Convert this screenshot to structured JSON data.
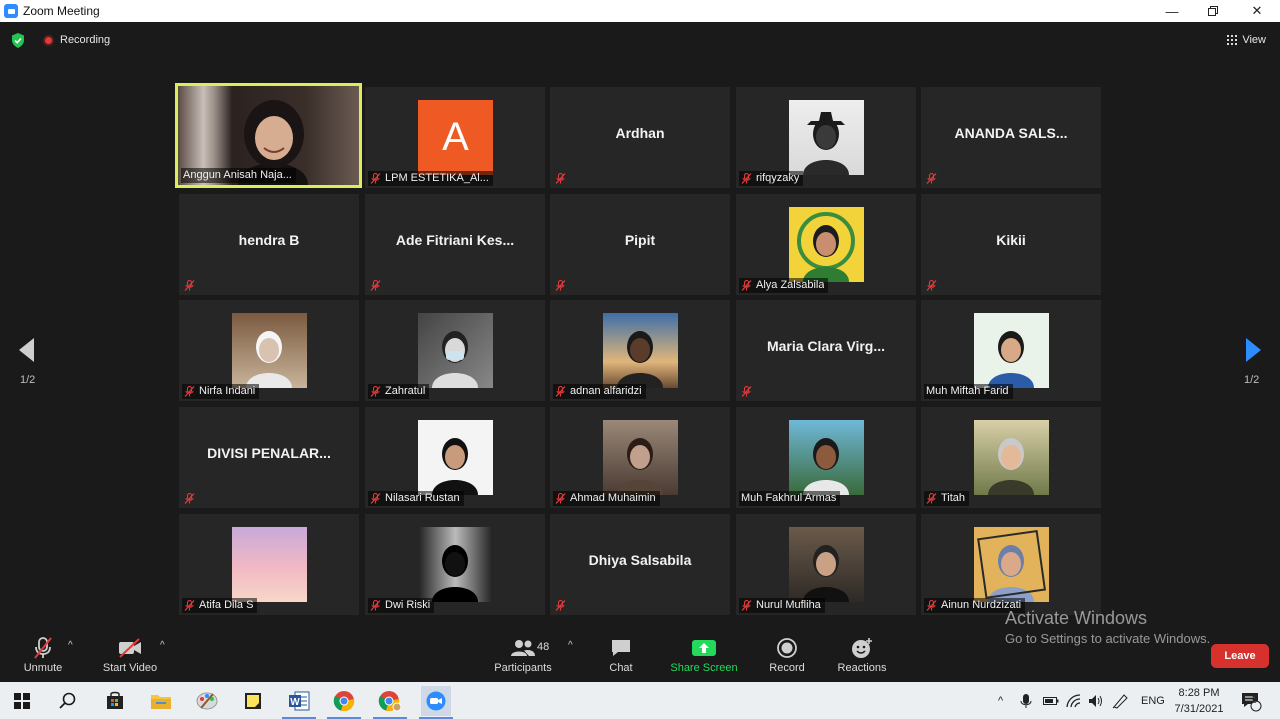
{
  "window": {
    "title": "Zoom Meeting",
    "controls": [
      "minimize",
      "restore",
      "close"
    ]
  },
  "meeting_top": {
    "recording_label": "Recording",
    "view_label": "View"
  },
  "nav": {
    "left_page": "1/2",
    "right_page": "1/2"
  },
  "participants_grid": [
    {
      "name": "Anggun Anisah Naja...",
      "muted": false,
      "display": "video",
      "active": true,
      "big_name": ""
    },
    {
      "name": "LPM ESTETIKA_Al...",
      "muted": true,
      "display": "avatar",
      "avatar_letter": "A",
      "avatar_color": "#ef5a24",
      "big_name": ""
    },
    {
      "name": "",
      "muted": true,
      "display": "name",
      "big_name": "Ardhan"
    },
    {
      "name": "rifqyzaky",
      "muted": true,
      "display": "photo",
      "big_name": ""
    },
    {
      "name": "",
      "muted": true,
      "display": "name",
      "big_name": "ANANDA SALS..."
    },
    {
      "name": "",
      "muted": true,
      "display": "name",
      "big_name": "hendra B"
    },
    {
      "name": "",
      "muted": true,
      "display": "name",
      "big_name": "Ade Fitriani Kes..."
    },
    {
      "name": "",
      "muted": true,
      "display": "name",
      "big_name": "Pipit"
    },
    {
      "name": "Alya Zalsabila",
      "muted": true,
      "display": "photo",
      "big_name": ""
    },
    {
      "name": "",
      "muted": true,
      "display": "name",
      "big_name": "Kikii"
    },
    {
      "name": "Nirfa Indani",
      "muted": true,
      "display": "photo",
      "big_name": ""
    },
    {
      "name": "Zahratul",
      "muted": true,
      "display": "photo",
      "big_name": ""
    },
    {
      "name": "adnan alfaridzi",
      "muted": true,
      "display": "photo",
      "big_name": ""
    },
    {
      "name": "",
      "muted": true,
      "display": "name",
      "big_name": "Maria Clara Virg..."
    },
    {
      "name": "Muh Miftah Farid",
      "muted": false,
      "display": "photo",
      "big_name": ""
    },
    {
      "name": "",
      "muted": true,
      "display": "name",
      "big_name": "DIVISI PENALAR..."
    },
    {
      "name": "Nilasari Rustan",
      "muted": true,
      "display": "photo",
      "big_name": ""
    },
    {
      "name": "Ahmad Muhaimin",
      "muted": true,
      "display": "photo",
      "big_name": ""
    },
    {
      "name": "Muh Fakhrul Armas",
      "muted": false,
      "display": "photo",
      "big_name": ""
    },
    {
      "name": "Titah",
      "muted": true,
      "display": "photo",
      "big_name": ""
    },
    {
      "name": "Atifa Dila S",
      "muted": true,
      "display": "photo",
      "big_name": ""
    },
    {
      "name": "Dwi Riski",
      "muted": true,
      "display": "photo",
      "big_name": ""
    },
    {
      "name": "",
      "muted": true,
      "display": "name",
      "big_name": "Dhiya Salsabila"
    },
    {
      "name": "Nurul Mufliha",
      "muted": true,
      "display": "photo",
      "big_name": ""
    },
    {
      "name": "Ainun Nurdzizati",
      "muted": true,
      "display": "photo",
      "big_name": ""
    }
  ],
  "toolbar": {
    "unmute": "Unmute",
    "start_video": "Start Video",
    "participants": "Participants",
    "participants_count": "48",
    "chat": "Chat",
    "share_screen": "Share Screen",
    "record": "Record",
    "reactions": "Reactions",
    "leave": "Leave",
    "share_color": "#23d959"
  },
  "watermark": {
    "line1": "Activate Windows",
    "line2": "Go to Settings to activate Windows."
  },
  "taskbar": {
    "language": "ENG",
    "time": "8:28 PM",
    "date": "7/31/2021",
    "notifications": "5"
  }
}
